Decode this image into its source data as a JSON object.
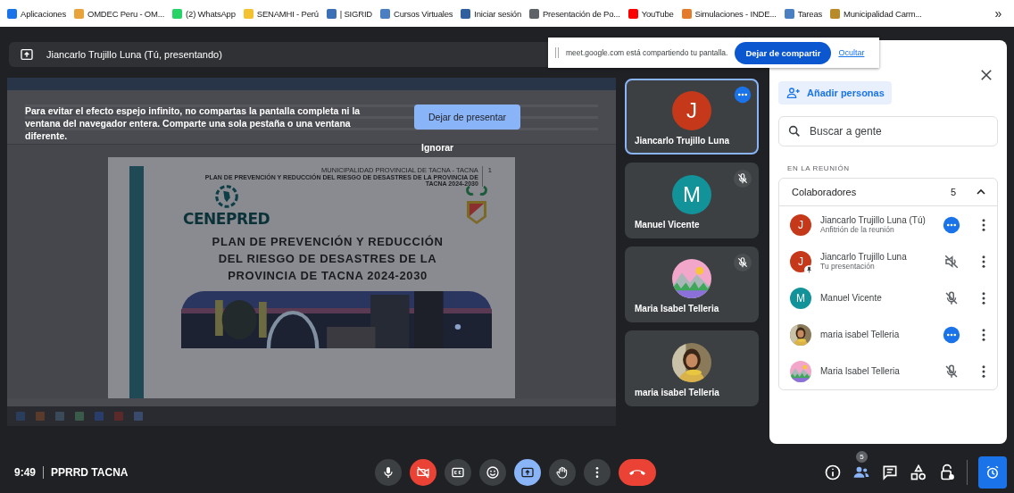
{
  "bookmarks": [
    {
      "label": "Aplicaciones",
      "color": "#1a73e8"
    },
    {
      "label": "OMDEC Peru - OM...",
      "color": "#e8a33a"
    },
    {
      "label": "(2) WhatsApp",
      "color": "#25d366"
    },
    {
      "label": "SENAMHI - Perú",
      "color": "#f2c230"
    },
    {
      "label": "| SIGRID",
      "color": "#3b6fb6"
    },
    {
      "label": "Cursos Virtuales",
      "color": "#4a7fc1"
    },
    {
      "label": "Iniciar sesión",
      "color": "#2f5f9e"
    },
    {
      "label": "Presentación de Po...",
      "color": "#5f6368"
    },
    {
      "label": "YouTube",
      "color": "#ff0000"
    },
    {
      "label": "Simulaciones - INDE...",
      "color": "#e37b2c"
    },
    {
      "label": "Tareas",
      "color": "#4a7fc1"
    },
    {
      "label": "Municipalidad Carm...",
      "color": "#b88a2a"
    }
  ],
  "bookmarks_overflow": "»",
  "presenter_bar": {
    "title": "Jiancarlo Trujillo Luna (Tú, presentando)"
  },
  "shared_screen": {
    "header_line_1": "MUNICIPALIDAD PROVINCIAL DE TACNA - TACNA",
    "page_number": "1",
    "header_line_2": "PLAN DE PREVENCIÓN Y REDUCCIÓN DEL RIESGO DE DESASTRES DE LA PROVINCIA DE TACNA 2024-2030",
    "logo_text": "CENEPRED",
    "title": "PLAN DE PREVENCIÓN Y REDUCCIÓN DEL RIESGO DE DESASTRES DE LA PROVINCIA DE TACNA 2024-2030"
  },
  "share_notice": {
    "message": "Para evitar el efecto espejo infinito, no compartas la pantalla completa ni la ventana del navegador entera. Comparte una sola pestaña o una ventana diferente.",
    "stop_button": "Dejar de presentar",
    "dismiss_button": "Ignorar"
  },
  "sharing_banner": {
    "message": "meet.google.com está compartiendo tu pantalla.",
    "stop_button": "Dejar de compartir",
    "hide_link": "Ocultar"
  },
  "tiles": [
    {
      "name": "Jiancarlo Trujillo Luna",
      "avatar": {
        "kind": "letter",
        "letter": "J",
        "color": "#c5391a"
      },
      "status": {
        "kind": "active"
      },
      "highlighted": true
    },
    {
      "name": "Manuel Vicente",
      "avatar": {
        "kind": "letter",
        "letter": "M",
        "color": "#12939a"
      },
      "status": {
        "kind": "muted"
      },
      "highlighted": false
    },
    {
      "name": "Maria Isabel Telleria",
      "avatar": {
        "kind": "landscape"
      },
      "status": {
        "kind": "muted"
      },
      "highlighted": false
    },
    {
      "name": "maria isabel Telleria",
      "avatar": {
        "kind": "person"
      },
      "highlighted": false
    }
  ],
  "people_panel": {
    "add_button": "Añadir personas",
    "search_placeholder": "Buscar a gente",
    "section_label": "EN LA REUNIÓN",
    "group": {
      "label": "Colaboradores",
      "count": "5",
      "expanded": true
    },
    "participants": [
      {
        "name": "Jiancarlo Trujillo Luna (Tú)",
        "subtitle": "Anfitrión de la reunión",
        "avatar": {
          "kind": "letter",
          "letter": "J",
          "color": "#c5391a"
        },
        "presenting": false,
        "status": {
          "kind": "active"
        }
      },
      {
        "name": "Jiancarlo Trujillo Luna",
        "subtitle": "Tu presentación",
        "avatar": {
          "kind": "letter",
          "letter": "J",
          "color": "#c5391a"
        },
        "presenting": true,
        "status": {
          "kind": "audio_off"
        }
      },
      {
        "name": "Manuel Vicente",
        "avatar": {
          "kind": "letter",
          "letter": "M",
          "color": "#12939a"
        },
        "presenting": false,
        "status": {
          "kind": "muted"
        }
      },
      {
        "name": "maria isabel Telleria",
        "avatar": {
          "kind": "person"
        },
        "presenting": false,
        "status": {
          "kind": "active"
        }
      },
      {
        "name": "Maria Isabel Telleria",
        "avatar": {
          "kind": "landscape"
        },
        "presenting": false,
        "status": {
          "kind": "muted"
        }
      }
    ]
  },
  "bottom_bar": {
    "time": "9:49",
    "meeting_name": "PPRRD TACNA",
    "controls": [
      {
        "kind": "mic",
        "active": false
      },
      {
        "kind": "camera_off",
        "active": false
      },
      {
        "kind": "captions",
        "active": false
      },
      {
        "kind": "emoji",
        "active": false
      },
      {
        "kind": "present",
        "active": true
      },
      {
        "kind": "hand",
        "active": false
      },
      {
        "kind": "more",
        "active": false
      },
      {
        "kind": "leave",
        "active": false
      }
    ],
    "side_icons": [
      {
        "kind": "info",
        "active": false
      },
      {
        "kind": "people",
        "active": true,
        "badge": "5"
      },
      {
        "kind": "chat",
        "active": false
      },
      {
        "kind": "activities",
        "active": false
      },
      {
        "kind": "lock",
        "active": false
      }
    ],
    "timer_button": {
      "active": true
    }
  }
}
